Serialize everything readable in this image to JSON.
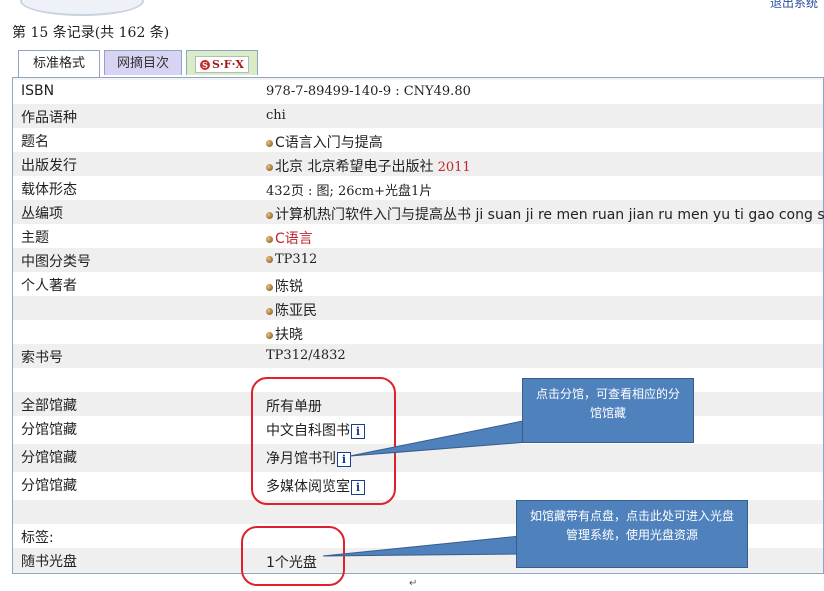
{
  "header": {
    "record_count": "第 15 条记录(共 162 条)",
    "top_link": "退出系统"
  },
  "tabs": [
    {
      "label": "标准格式"
    },
    {
      "label": "网摘目次"
    },
    {
      "label": "S·F·X"
    }
  ],
  "record": {
    "isbn": {
      "label": "ISBN",
      "value": "978-7-89499-140-9 : CNY49.80"
    },
    "language": {
      "label": "作品语种",
      "value": "chi"
    },
    "title": {
      "label": "题名",
      "value": "C语言入门与提高"
    },
    "publication": {
      "label": "出版发行",
      "value": "北京 北京希望电子出版社",
      "year": "2011"
    },
    "physical": {
      "label": "载体形态",
      "value": "432页 : 图; 26cm+光盘1片"
    },
    "series": {
      "label": "丛编项",
      "value": "计算机热门软件入门与提高丛书 ji suan ji re men ruan jian ru men yu ti gao cong shu"
    },
    "subject": {
      "label": "主题",
      "value": "C语言"
    },
    "classification": {
      "label": "中图分类号",
      "value": "TP312"
    },
    "authors": {
      "label": "个人著者",
      "values": [
        "陈锐",
        "陈亚民",
        "扶晓"
      ]
    },
    "call_number": {
      "label": "索书号",
      "value": "TP312/4832"
    }
  },
  "holdings": {
    "all": {
      "label": "全部馆藏",
      "value": "所有单册"
    },
    "branches": [
      {
        "label": "分馆馆藏",
        "value": "中文自科图书"
      },
      {
        "label": "分馆馆藏",
        "value": "净月馆书刊"
      },
      {
        "label": "分馆馆藏",
        "value": "多媒体阅览室"
      }
    ]
  },
  "tags": {
    "label": "标签:"
  },
  "disc": {
    "label": "随书光盘",
    "value": "1个光盘"
  },
  "annotations": {
    "branch_tip": "点击分馆，可查看相应的分馆馆藏",
    "disc_tip": "如馆藏带有点盘，点击此处可进入光盘管理系统，使用光盘资源"
  },
  "icons": {
    "info": "info-icon",
    "bullet": "bullet-icon",
    "sfx": "sfx-logo-icon"
  },
  "colors": {
    "panel_border": "#8fa3c6",
    "callout_fill": "#4f81bd",
    "highlight_ring": "#e0212b",
    "accent_red": "#c0262d"
  }
}
